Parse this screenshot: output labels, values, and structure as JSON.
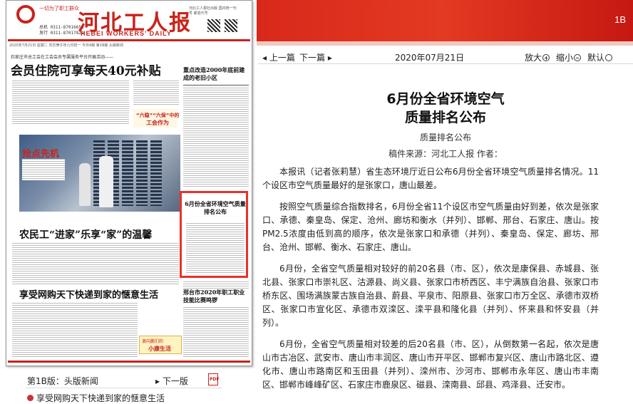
{
  "header": {
    "page_no": "1B"
  },
  "paper": {
    "motto": "一切为了职工群众",
    "phone1": "总机 0311-87016656",
    "phone2": "发行 0311-87017821",
    "title": "河北工人报",
    "subtitle": "HEBEI WORKERS' DAILY",
    "info": "河北工人报社出版 国内统一刊号 邮发代号",
    "dateline": "2020年7月21日 星期二 农历庚子年六月初一 今日4版 第1B版 头版新闻",
    "headline_small": "石家庄市总工会在工会会员专属服务平台开展活动——",
    "headline": "会员住院可享每天40元补贴",
    "right_head1": "重点改造2000年底前建成的老旧小区",
    "box_label1": "“六稳”“六保”中的",
    "box_label2": "工会作为",
    "photo_label": "抢点先机",
    "red_box_title": "6月份全省环境空气质量排名公布",
    "headline3": "农民工“进家”乐享“家”的温馨",
    "headline4": "享受网购天下快递到家的惬意生活",
    "right_head2": "邢台市2020年职工职业技能比赛鸣锣",
    "ad1": "滚向鹏们的",
    "ad2": "小康生活"
  },
  "left_nav": {
    "edition": "第1B版：头版新闻",
    "next": "下一版",
    "pdf_icon": "pdf-icon",
    "list_item": "享受网购天下快递到家的惬意生活"
  },
  "toolbar": {
    "prev": "上一篇",
    "next": "下一篇",
    "date": "2020年07月21日",
    "zoom_in": "放大",
    "zoom_out": "缩小",
    "default": "默认"
  },
  "article": {
    "title_line1": "6月份全省环境空气",
    "title_line2": "质量排名公布",
    "subtitle": "质量排名公布",
    "meta": "稿件来源：河北工人报  作者：",
    "paragraphs": [
      "本报讯（记者张莉慧）省生态环境厅近日公布6月份全省环境空气质量排名情况。11个设区市空气质量最好的是张家口，唐山最差。",
      "按照空气质量综合指数排名，6月份全省11个设区市空气质量由好到差，依次是张家口、承德、秦皇岛、保定、沧州、廊坊和衡水（并列）、邯郸、邢台、石家庄、唐山。按PM2.5浓度由低到高的顺序，依次是张家口和承德（并列）、秦皇岛、保定、廊坊、邢台、沧州、邯郸、衡水、石家庄、唐山。",
      "6月份，全省空气质量相对较好的前20名县（市、区），依次是康保县、赤城县、张北县、张家口市崇礼区、沽源县、尚义县、张家口市桥西区、丰宁满族自治县、张家口市桥东区、围场满族蒙古族自治县、蔚县、平泉市、阳原县、张家口市万全区、承德市双桥区、张家口市宣化区、承德市双滦区、滦平县和隆化县（并列）、怀来县和怀安县（并列）。",
      "6月份，全省空气质量相对较差的后20名县（市、区），从倒数第一名起，依次是唐山市古冶区、武安市、唐山市丰润区、唐山市开平区、邯郸市复兴区、唐山市路北区、遵化市、唐山市路南区和玉田县（并列）、滦州市、沙河市、邯郸市永年区、唐山市丰南区、邯郸市峰峰矿区、石家庄市鹿泉区、磁县、滦南县、邱县、鸡泽县、迁安市。"
    ]
  }
}
